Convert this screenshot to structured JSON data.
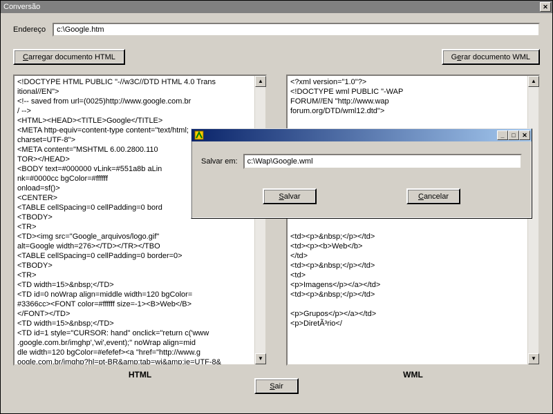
{
  "window": {
    "title": "Conversão",
    "close_glyph": "✕"
  },
  "address": {
    "label": "Endereço",
    "value": "c:\\Google.htm"
  },
  "buttons": {
    "load_html": "Carregar documento HTML",
    "gen_wml_pre": "G",
    "gen_wml_u": "e",
    "gen_wml_post": "rar documento WML",
    "sair_u": "S",
    "sair_post": "air"
  },
  "panes": {
    "html_label": "HTML",
    "wml_label": "WML",
    "html_text": "<!DOCTYPE HTML PUBLIC \"-//w3C//DTD HTML 4.0 Trans\nitional//EN\">\n<!-- saved from url=(0025)http://www.google.com.br\n/ -->\n<HTML><HEAD><TITLE>Google</TITLE>\n<META http-equiv=content-type content=\"text/html;\ncharset=UTF-8\">\n<META content=\"MSHTML 6.00.2800.110\nTOR></HEAD>\n<BODY text=#000000 vLink=#551a8b aLin\nnk=#0000cc bgColor=#ffffff\nonload=sf()>\n<CENTER>\n<TABLE cellSpacing=0 cellPadding=0 bord\n<TBODY>\n<TR>\n<TD><img src=\"Google_arquivos/logo.gif\"\nalt=Google width=276></TD></TR></TBO\n<TABLE cellSpacing=0 cellPadding=0 border=0>\n<TBODY>\n<TR>\n<TD width=15>&nbsp;</TD>\n<TD id=0 noWrap align=middle width=120 bgColor=\n#3366cc><FONT color=#ffffff size=-1><B>Web</B>\n</FONT></TD>\n<TD width=15>&nbsp;</TD>\n<TD id=1 style=\"CURSOR: hand\" onclick=\"return c('www\n.google.com.br/imghp','wi',event);\" noWrap align=mid\ndle width=120 bgColor=#efefef><a \"href=\"http://www.g\noogle.com.br/imghp?hl=pt-BR&amp;tab=wi&amp;ie=UTF-8&",
    "wml_text": "<?xml version=\"1.0\"?>\n<!DOCTYPE wml PUBLIC \"-WAP\nFORUM//EN \"http://www.wap\nforum.org/DTD/wml12.dtd\">\n\n\n\n\n\n\n\n\nble><br/>\n\n\n\n<td><p>&nbsp;</p></td>\n<td><p><b>Web</b>\n</td>\n<td><p>&nbsp;</p></td>\n<td>\n<p>Imagens</p></a></td>\n<td><p>&nbsp;</p></td>\n\n<p>Grupos</p></a></td>\n<p>DiretÃ³rio</"
  },
  "scroll": {
    "up": "▲",
    "down": "▼"
  },
  "dialog": {
    "save_in_label": "Salvar em:",
    "path_value": "c:\\Wap\\Google.wml",
    "salvar_u": "S",
    "salvar_post": "alvar",
    "cancelar_u": "C",
    "cancelar_post": "ancelar",
    "min_glyph": "_",
    "max_glyph": "□",
    "close_glyph": "✕"
  }
}
